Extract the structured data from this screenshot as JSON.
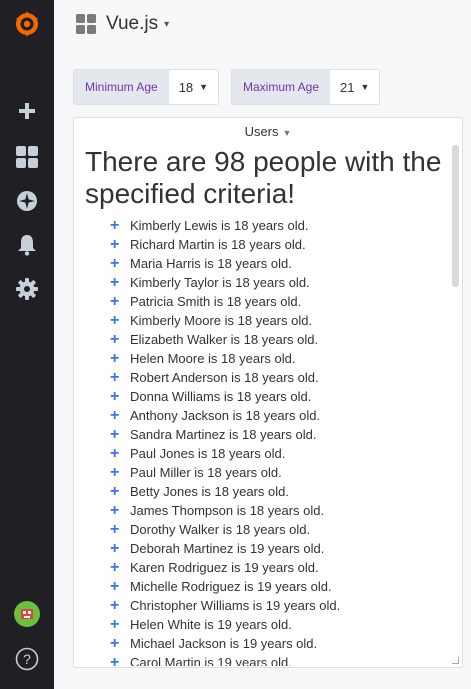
{
  "sidebar": {
    "icons": [
      "grafana-logo-icon",
      "plus-icon",
      "dashboards-icon",
      "explore-icon",
      "alerting-bell-icon",
      "configuration-gear-icon",
      "user-avatar",
      "help-icon"
    ],
    "help_glyph": "?"
  },
  "header": {
    "title": "Vue.js",
    "caret": "▾"
  },
  "variables": [
    {
      "label": "Minimum Age",
      "value": "18"
    },
    {
      "label": "Maximum Age",
      "value": "21"
    }
  ],
  "panel": {
    "title": "Users",
    "headline": "There are 98 people with the specified criteria!",
    "people": [
      "Kimberly Lewis is 18 years old.",
      "Richard Martin is 18 years old.",
      "Maria Harris is 18 years old.",
      "Kimberly Taylor is 18 years old.",
      "Patricia Smith is 18 years old.",
      "Kimberly Moore is 18 years old.",
      "Elizabeth Walker is 18 years old.",
      "Helen Moore is 18 years old.",
      "Robert Anderson is 18 years old.",
      "Donna Williams is 18 years old.",
      "Anthony Jackson is 18 years old.",
      "Sandra Martinez is 18 years old.",
      "Paul Jones is 18 years old.",
      "Paul Miller is 18 years old.",
      "Betty Jones is 18 years old.",
      "James Thompson is 18 years old.",
      "Dorothy Walker is 18 years old.",
      "Deborah Martinez is 19 years old.",
      "Karen Rodriguez is 19 years old.",
      "Michelle Rodriguez is 19 years old.",
      "Christopher Williams is 19 years old.",
      "Helen White is 19 years old.",
      "Michael Jackson is 19 years old.",
      "Carol Martin is 19 years old."
    ]
  },
  "colors": {
    "sidebar_bg": "#1f1f24",
    "accent_plus": "#3578e5",
    "label_purple": "#6f35a3",
    "logo_orange": "#f46800"
  }
}
